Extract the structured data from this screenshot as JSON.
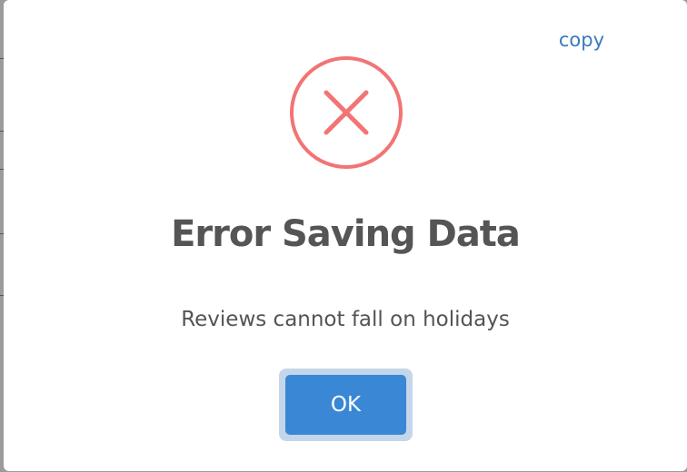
{
  "dialog": {
    "copy_label": "copy",
    "icon": "error-x-circle-icon",
    "title": "Error Saving Data",
    "message": "Reviews cannot fall on holidays",
    "ok_label": "OK"
  },
  "colors": {
    "icon_color": "#f27474",
    "link_color": "#3b7ab8",
    "button_color": "#3a87d6",
    "button_focus_ring": "#c4d6ea",
    "title_color": "#555555",
    "text_color": "#545454"
  }
}
